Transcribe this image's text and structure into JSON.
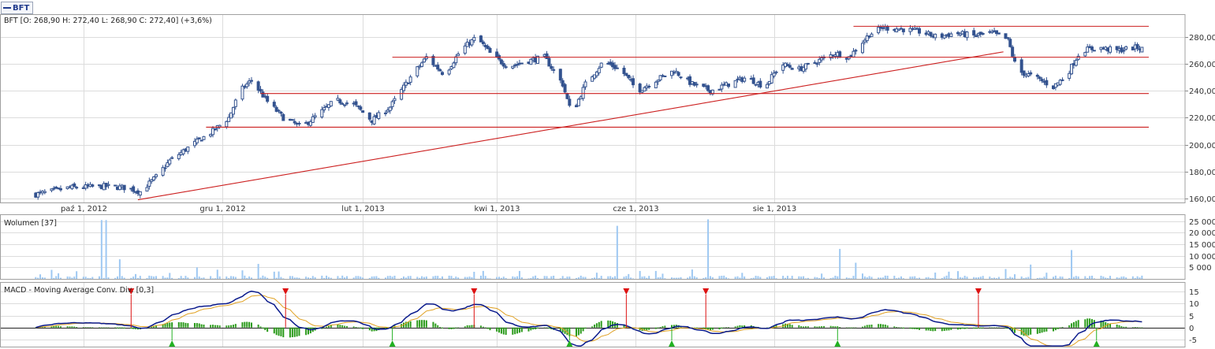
{
  "legend": {
    "symbol": "BFT"
  },
  "price_title": "BFT [O: 268,90  H: 272,40  L: 268,90  C: 272,40] (+3,6%)",
  "volume_title": "Wolumen [37]",
  "macd_title": "MACD - Moving Average Conv. Div. [0,3]",
  "colors": {
    "candle": "#33528f",
    "trend": "#cc1f1f",
    "volume": "#9ec8f2",
    "macd": "#0a1a8c",
    "signal": "#e0a020",
    "hist": "#2a9a1a",
    "grid": "#dcdcdc",
    "up_marker": "#22b022",
    "down_marker": "#dd1111"
  },
  "chart_data": [
    {
      "type": "candlestick",
      "title": "BFT [O: 268,90  H: 272,40  L: 268,90  C: 272,40] (+3,6%)",
      "x_ticks": [
        "paź 1, 2012",
        "gru 1, 2012",
        "lut 1, 2013",
        "kwi 1, 2013",
        "cze 1, 2013",
        "sie 1, 2013"
      ],
      "y_ticks": [
        "160,00",
        "180,00",
        "200,00",
        "220,00",
        "240,00",
        "260,00",
        "280,00"
      ],
      "ylim": [
        157,
        297
      ],
      "grid": true,
      "last": {
        "open": 268.9,
        "high": 272.4,
        "low": 268.9,
        "close": 272.4
      },
      "close_anchors": [
        [
          "2012-09-10",
          163
        ],
        [
          "2012-09-25",
          168
        ],
        [
          "2012-10-10",
          169
        ],
        [
          "2012-10-20",
          168
        ],
        [
          "2012-10-26",
          165
        ],
        [
          "2012-11-02",
          176
        ],
        [
          "2012-11-08",
          188
        ],
        [
          "2012-11-18",
          200
        ],
        [
          "2012-11-27",
          210
        ],
        [
          "2012-12-04",
          220
        ],
        [
          "2012-12-09",
          240
        ],
        [
          "2012-12-14",
          248
        ],
        [
          "2012-12-21",
          232
        ],
        [
          "2012-12-28",
          220
        ],
        [
          "2013-01-05",
          213
        ],
        [
          "2013-01-12",
          222
        ],
        [
          "2013-01-20",
          233
        ],
        [
          "2013-01-28",
          230
        ],
        [
          "2013-02-05",
          218
        ],
        [
          "2013-02-13",
          228
        ],
        [
          "2013-02-22",
          250
        ],
        [
          "2013-03-01",
          265
        ],
        [
          "2013-03-09",
          252
        ],
        [
          "2013-03-16",
          270
        ],
        [
          "2013-03-23",
          280
        ],
        [
          "2013-03-30",
          266
        ],
        [
          "2013-04-06",
          258
        ],
        [
          "2013-04-14",
          262
        ],
        [
          "2013-04-22",
          265
        ],
        [
          "2013-04-30",
          245
        ],
        [
          "2013-05-04",
          222
        ],
        [
          "2013-05-10",
          245
        ],
        [
          "2013-05-18",
          262
        ],
        [
          "2013-05-26",
          255
        ],
        [
          "2013-06-02",
          240
        ],
        [
          "2013-06-10",
          248
        ],
        [
          "2013-06-18",
          255
        ],
        [
          "2013-06-26",
          245
        ],
        [
          "2013-07-04",
          240
        ],
        [
          "2013-07-12",
          245
        ],
        [
          "2013-07-20",
          250
        ],
        [
          "2013-07-28",
          243
        ],
        [
          "2013-08-04",
          260
        ],
        [
          "2013-08-12",
          256
        ],
        [
          "2013-08-20",
          262
        ],
        [
          "2013-08-28",
          268
        ],
        [
          "2013-09-03",
          265
        ],
        [
          "2013-09-12",
          282
        ],
        [
          "2013-09-18",
          287
        ],
        [
          "2013-09-26",
          286
        ],
        [
          "2013-10-04",
          284
        ],
        [
          "2013-10-12",
          280
        ],
        [
          "2013-10-20",
          283
        ],
        [
          "2013-10-28",
          281
        ],
        [
          "2013-11-05",
          283
        ],
        [
          "2013-11-12",
          278
        ],
        [
          "2013-11-16",
          255
        ],
        [
          "2013-11-24",
          250
        ],
        [
          "2013-12-02",
          243
        ],
        [
          "2013-12-08",
          252
        ],
        [
          "2013-12-14",
          270
        ],
        [
          "2013-12-22",
          272
        ],
        [
          "2013-12-30",
          270
        ],
        [
          "2014-01-06",
          272
        ],
        [
          "2014-01-10",
          272.4
        ]
      ],
      "trend_lines": [
        {
          "from": [
            "2012-11-24",
            213
          ],
          "to": [
            "2014-01-13",
            213
          ]
        },
        {
          "from": [
            "2012-12-18",
            238
          ],
          "to": [
            "2014-01-13",
            238
          ]
        },
        {
          "from": [
            "2013-02-14",
            265
          ],
          "to": [
            "2014-01-13",
            265
          ]
        },
        {
          "from": [
            "2013-09-05",
            288
          ],
          "to": [
            "2014-01-13",
            288
          ]
        },
        {
          "from": [
            "2012-10-25",
            159
          ],
          "to": [
            "2013-11-10",
            269
          ]
        }
      ]
    },
    {
      "type": "bar",
      "title": "Wolumen [37]",
      "y_ticks": [
        "5 000",
        "10 000",
        "15 000",
        "20 000",
        "25 000"
      ],
      "ylim": [
        0,
        28000
      ],
      "base": 900,
      "spikes": [
        [
          "2012-10-09",
          25500
        ],
        [
          "2012-10-11",
          25500
        ],
        [
          "2012-10-17",
          8500
        ],
        [
          "2012-11-20",
          5000
        ],
        [
          "2012-11-24",
          4800
        ],
        [
          "2012-12-01",
          3500
        ],
        [
          "2012-12-17",
          6500
        ],
        [
          "2013-02-03",
          9000
        ],
        [
          "2013-05-24",
          23000
        ],
        [
          "2013-07-03",
          25800
        ],
        [
          "2013-08-30",
          13000
        ],
        [
          "2013-11-22",
          6200
        ],
        [
          "2013-12-07",
          16500
        ],
        [
          "2013-12-10",
          12500
        ],
        [
          "2013-12-14",
          11200
        ],
        [
          "2013-09-06",
          7000
        ]
      ]
    },
    {
      "type": "line",
      "title": "MACD - Moving Average Conv. Div. [0,3]",
      "y_ticks": [
        "-5",
        "0",
        "5",
        "10",
        "15"
      ],
      "ylim": [
        -8,
        19
      ],
      "series_colors": {
        "macd": "#0a1a8c",
        "signal": "#e0a020",
        "histogram": "#2a9a1a"
      },
      "signals": {
        "buy": [
          "2012-11-09",
          "2013-02-14",
          "2013-05-03",
          "2013-06-17",
          "2013-08-29",
          "2013-12-21"
        ],
        "sell": [
          "2012-10-22",
          "2012-12-29",
          "2013-03-22",
          "2013-05-28",
          "2013-07-02",
          "2013-10-30"
        ]
      }
    }
  ]
}
